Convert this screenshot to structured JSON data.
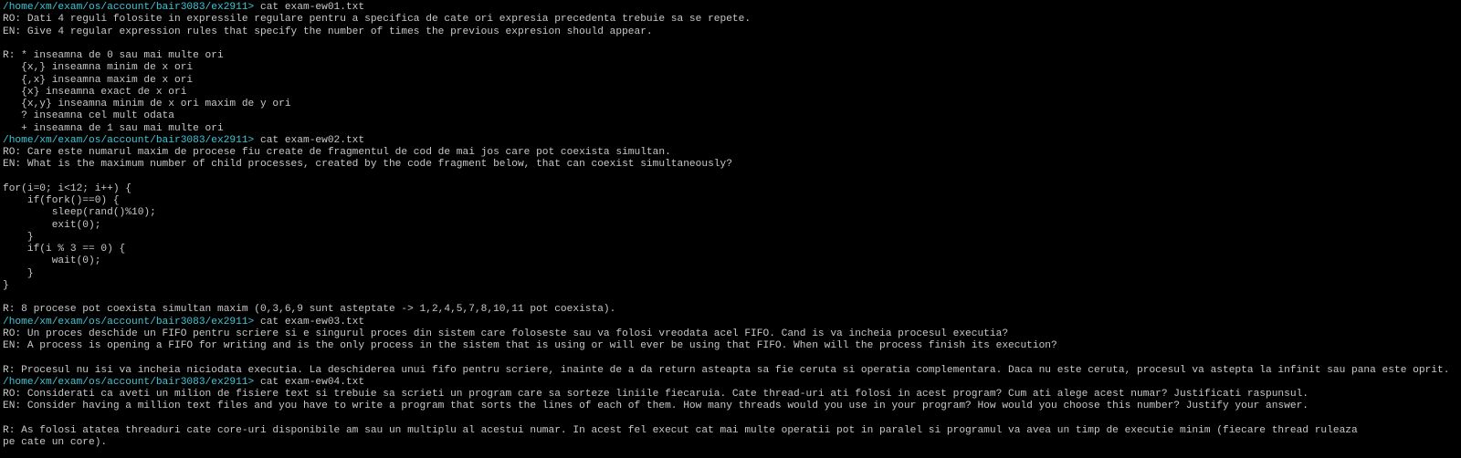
{
  "colors": {
    "background": "#000000",
    "text": "#c8c8c8",
    "prompt": "#3ec7d6"
  },
  "lines": [
    {
      "prompt": "/home/xm/exam/os/account/bair3083/ex2911>",
      "cmd": " cat exam-ew01.txt"
    },
    {
      "text": "RO: Dati 4 reguli folosite in expressile regulare pentru a specifica de cate ori expresia precedenta trebuie sa se repete."
    },
    {
      "text": "EN: Give 4 regular expression rules that specify the number of times the previous expresion should appear."
    },
    {
      "text": ""
    },
    {
      "text": "R: * inseamna de 0 sau mai multe ori"
    },
    {
      "text": "   {x,} inseamna minim de x ori"
    },
    {
      "text": "   {,x} inseamna maxim de x ori"
    },
    {
      "text": "   {x} inseamna exact de x ori"
    },
    {
      "text": "   {x,y} inseamna minim de x ori maxim de y ori"
    },
    {
      "text": "   ? inseamna cel mult odata"
    },
    {
      "text": "   + inseamna de 1 sau mai multe ori"
    },
    {
      "prompt": "/home/xm/exam/os/account/bair3083/ex2911>",
      "cmd": " cat exam-ew02.txt"
    },
    {
      "text": "RO: Care este numarul maxim de procese fiu create de fragmentul de cod de mai jos care pot coexista simultan."
    },
    {
      "text": "EN: What is the maximum number of child processes, created by the code fragment below, that can coexist simultaneously?"
    },
    {
      "text": ""
    },
    {
      "text": "for(i=0; i<12; i++) {"
    },
    {
      "text": "    if(fork()==0) {"
    },
    {
      "text": "        sleep(rand()%10);"
    },
    {
      "text": "        exit(0);"
    },
    {
      "text": "    }"
    },
    {
      "text": "    if(i % 3 == 0) {"
    },
    {
      "text": "        wait(0);"
    },
    {
      "text": "    }"
    },
    {
      "text": "}"
    },
    {
      "text": ""
    },
    {
      "text": "R: 8 procese pot coexista simultan maxim (0,3,6,9 sunt asteptate -> 1,2,4,5,7,8,10,11 pot coexista)."
    },
    {
      "prompt": "/home/xm/exam/os/account/bair3083/ex2911>",
      "cmd": " cat exam-ew03.txt"
    },
    {
      "text": "RO: Un proces deschide un FIFO pentru scriere si e singurul proces din sistem care foloseste sau va folosi vreodata acel FIFO. Cand is va incheia procesul executia?"
    },
    {
      "text": "EN: A process is opening a FIFO for writing and is the only process in the sistem that is using or will ever be using that FIFO. When will the process finish its execution?"
    },
    {
      "text": ""
    },
    {
      "text": "R: Procesul nu isi va incheia niciodata executia. La deschiderea unui fifo pentru scriere, inainte de a da return asteapta sa fie ceruta si operatia complementara. Daca nu este ceruta, procesul va astepta la infinit sau pana este oprit."
    },
    {
      "prompt": "/home/xm/exam/os/account/bair3083/ex2911>",
      "cmd": " cat exam-ew04.txt"
    },
    {
      "text": "RO: Considerati ca aveti un milion de fisiere text si trebuie sa scrieti un program care sa sorteze liniile fiecaruia. Cate thread-uri ati folosi in acest program? Cum ati alege acest numar? Justificati raspunsul."
    },
    {
      "text": "EN: Consider having a million text files and you have to write a program that sorts the lines of each of them. How many threads would you use in your program? How would you choose this number? Justify your answer."
    },
    {
      "text": ""
    },
    {
      "text": "R: As folosi atatea threaduri cate core-uri disponibile am sau un multiplu al acestui numar. In acest fel execut cat mai multe operatii pot in paralel si programul va avea un timp de executie minim (fiecare thread ruleaza"
    },
    {
      "text": "pe cate un core)."
    }
  ]
}
